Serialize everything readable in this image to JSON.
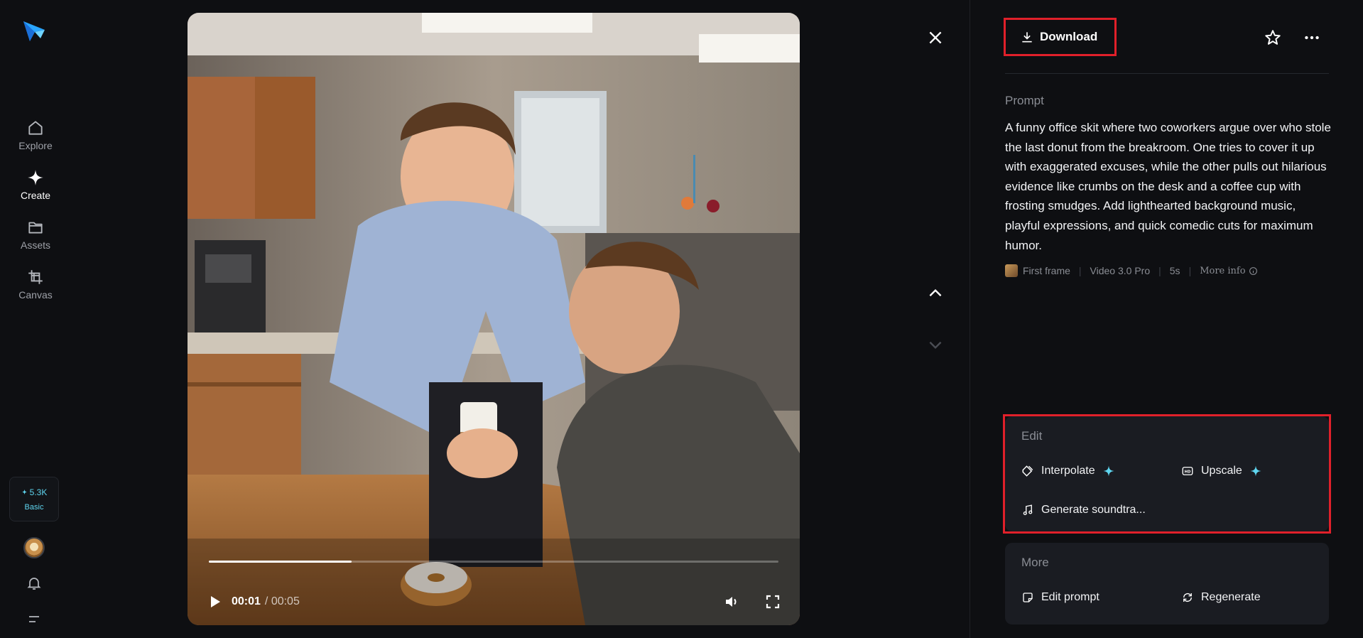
{
  "nav": {
    "items": [
      {
        "label": "Explore",
        "icon": "home-icon"
      },
      {
        "label": "Create",
        "icon": "sparkle-icon"
      },
      {
        "label": "Assets",
        "icon": "folder-icon"
      },
      {
        "label": "Canvas",
        "icon": "crop-icon"
      }
    ],
    "credits": {
      "value": "5.3K",
      "plan": "Basic"
    }
  },
  "player": {
    "current_time": "00:01",
    "total_time": "/ 00:05",
    "progress": 0.25
  },
  "toolbar": {
    "download_label": "Download"
  },
  "prompt": {
    "label": "Prompt",
    "text": "A funny office skit where two coworkers argue over who stole the last donut from the breakroom. One tries to cover it up with exaggerated excuses, while the other pulls out hilarious evidence like crumbs on the desk and a coffee cup with frosting smudges. Add lighthearted background music, playful expressions, and quick comedic cuts for maximum humor."
  },
  "meta": {
    "first_frame": "First frame",
    "model": "Video 3.0 Pro",
    "duration": "5s",
    "more_info": "More info"
  },
  "edit": {
    "title": "Edit",
    "interpolate": "Interpolate",
    "upscale": "Upscale",
    "soundtrack": "Generate soundtra..."
  },
  "more": {
    "title": "More",
    "edit_prompt": "Edit prompt",
    "regenerate": "Regenerate"
  },
  "colors": {
    "accent": "#5fd6f0",
    "highlight": "#e0202a",
    "background": "#0e0f12",
    "card": "#1a1c22"
  }
}
